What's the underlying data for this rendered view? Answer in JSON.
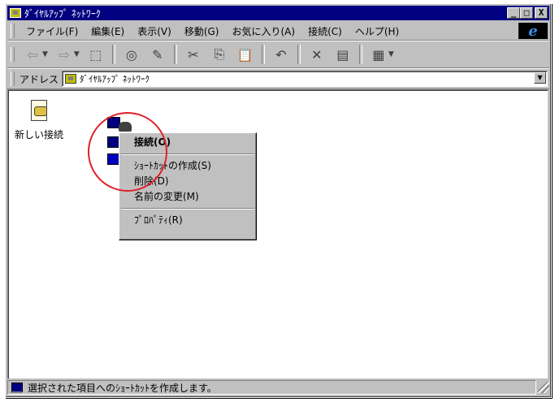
{
  "window": {
    "title": "ﾀﾞｲﾔﾙｱｯﾌﾟ ﾈｯﾄﾜｰｸ",
    "minimize_label": "_",
    "maximize_label": "□",
    "close_label": "X"
  },
  "menubar": {
    "items": [
      {
        "label": "ファイル(F)"
      },
      {
        "label": "編集(E)"
      },
      {
        "label": "表示(V)"
      },
      {
        "label": "移動(G)"
      },
      {
        "label": "お気に入り(A)"
      },
      {
        "label": "接続(C)"
      },
      {
        "label": "ヘルプ(H)"
      }
    ],
    "logo": "e"
  },
  "toolbar": {
    "back_icon": "⇦",
    "forward_icon": "⇨",
    "up_icon": "⬚",
    "map_drive_icon": "◎",
    "disconnect_icon": "✎",
    "cut_icon": "✂",
    "copy_icon": "⎘",
    "paste_icon": "📋",
    "undo_icon": "↶",
    "delete_icon": "✕",
    "properties_icon": "▤",
    "views_icon": "▦",
    "dropdown": "▼"
  },
  "address": {
    "label": "アドレス",
    "value": "ﾀﾞｲﾔﾙｱｯﾌﾟ ﾈｯﾄﾜｰｸ",
    "dropdown": "▼"
  },
  "content": {
    "new_connection_label": "新しい接続"
  },
  "context_menu": {
    "items": [
      {
        "label": "接続(O)",
        "bold": true
      },
      {
        "label": "ｼｮｰﾄｶｯﾄの作成(S)"
      },
      {
        "label": "削除(D)"
      },
      {
        "label": "名前の変更(M)"
      },
      {
        "label": "ﾌﾟﾛﾊﾟﾃｨ(R)"
      }
    ]
  },
  "status": {
    "text": "選択された項目へのｼｮｰﾄｶｯﾄを作成します。"
  },
  "colors": {
    "titlebar": "#000080",
    "face": "#c0c0c0",
    "highlight_circle": "#e0202a"
  }
}
